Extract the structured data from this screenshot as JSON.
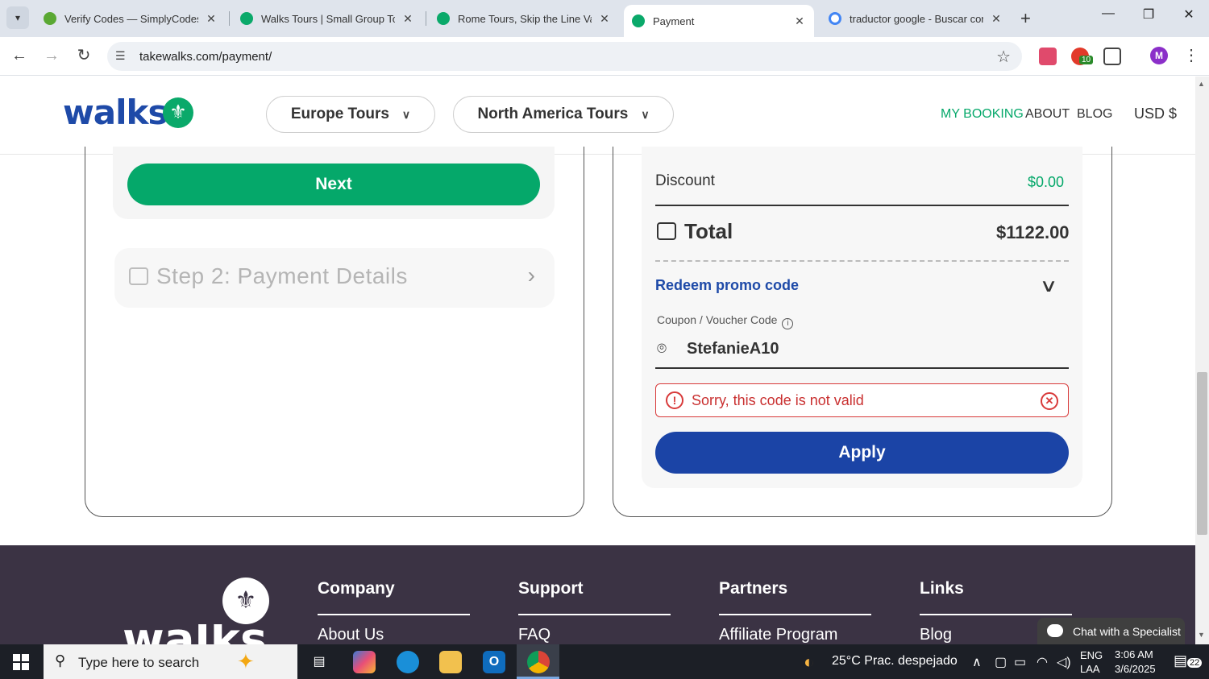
{
  "browser": {
    "tabs": [
      {
        "title": "Verify Codes — SimplyCodes",
        "favicon_color": "#5aa833"
      },
      {
        "title": "Walks Tours | Small Group Tours",
        "favicon_color": "#0aa96a"
      },
      {
        "title": "Rome Tours, Skip the Line Vatican",
        "favicon_color": "#0aa96a"
      },
      {
        "title": "Payment",
        "favicon_color": "#0aa96a",
        "active": true
      },
      {
        "title": "traductor google - Buscar con Google",
        "favicon_color": "#4285f4"
      }
    ],
    "url": "takewalks.com/payment/",
    "profile_initial": "M",
    "extension_badge": "10"
  },
  "site": {
    "logo_text": "walks",
    "nav_pills": [
      "Europe Tours",
      "North America Tours"
    ],
    "top_links": [
      "MY BOOKING",
      "ABOUT",
      "BLOG"
    ],
    "currency": "USD $",
    "accent_green": "#05a86a",
    "accent_blue": "#1b44a6"
  },
  "checkout": {
    "next_label": "Next",
    "step2_label": "Step 2: Payment Details"
  },
  "summary": {
    "discount_label": "Discount",
    "discount_value": "$0.00",
    "total_label": "Total",
    "total_value": "$1122.00",
    "promo_link": "Redeem promo code",
    "coupon_label": "Coupon / Voucher Code",
    "coupon_value": "StefanieA10",
    "error_message": "Sorry, this code is not valid",
    "apply_label": "Apply"
  },
  "footer": {
    "logo_text": "walks",
    "columns": [
      {
        "title": "Company",
        "first_link": "About Us"
      },
      {
        "title": "Support",
        "first_link": "FAQ"
      },
      {
        "title": "Partners",
        "first_link": "Affiliate Program"
      },
      {
        "title": "Links",
        "first_link": "Blog"
      }
    ],
    "chat_label": "Chat with a Specialist"
  },
  "taskbar": {
    "search_placeholder": "Type here to search",
    "weather": "25°C  Prac. despejado",
    "lang_top": "ENG",
    "lang_bottom": "LAA",
    "time": "3:06 AM",
    "date": "3/6/2025",
    "notif_count": "22"
  }
}
